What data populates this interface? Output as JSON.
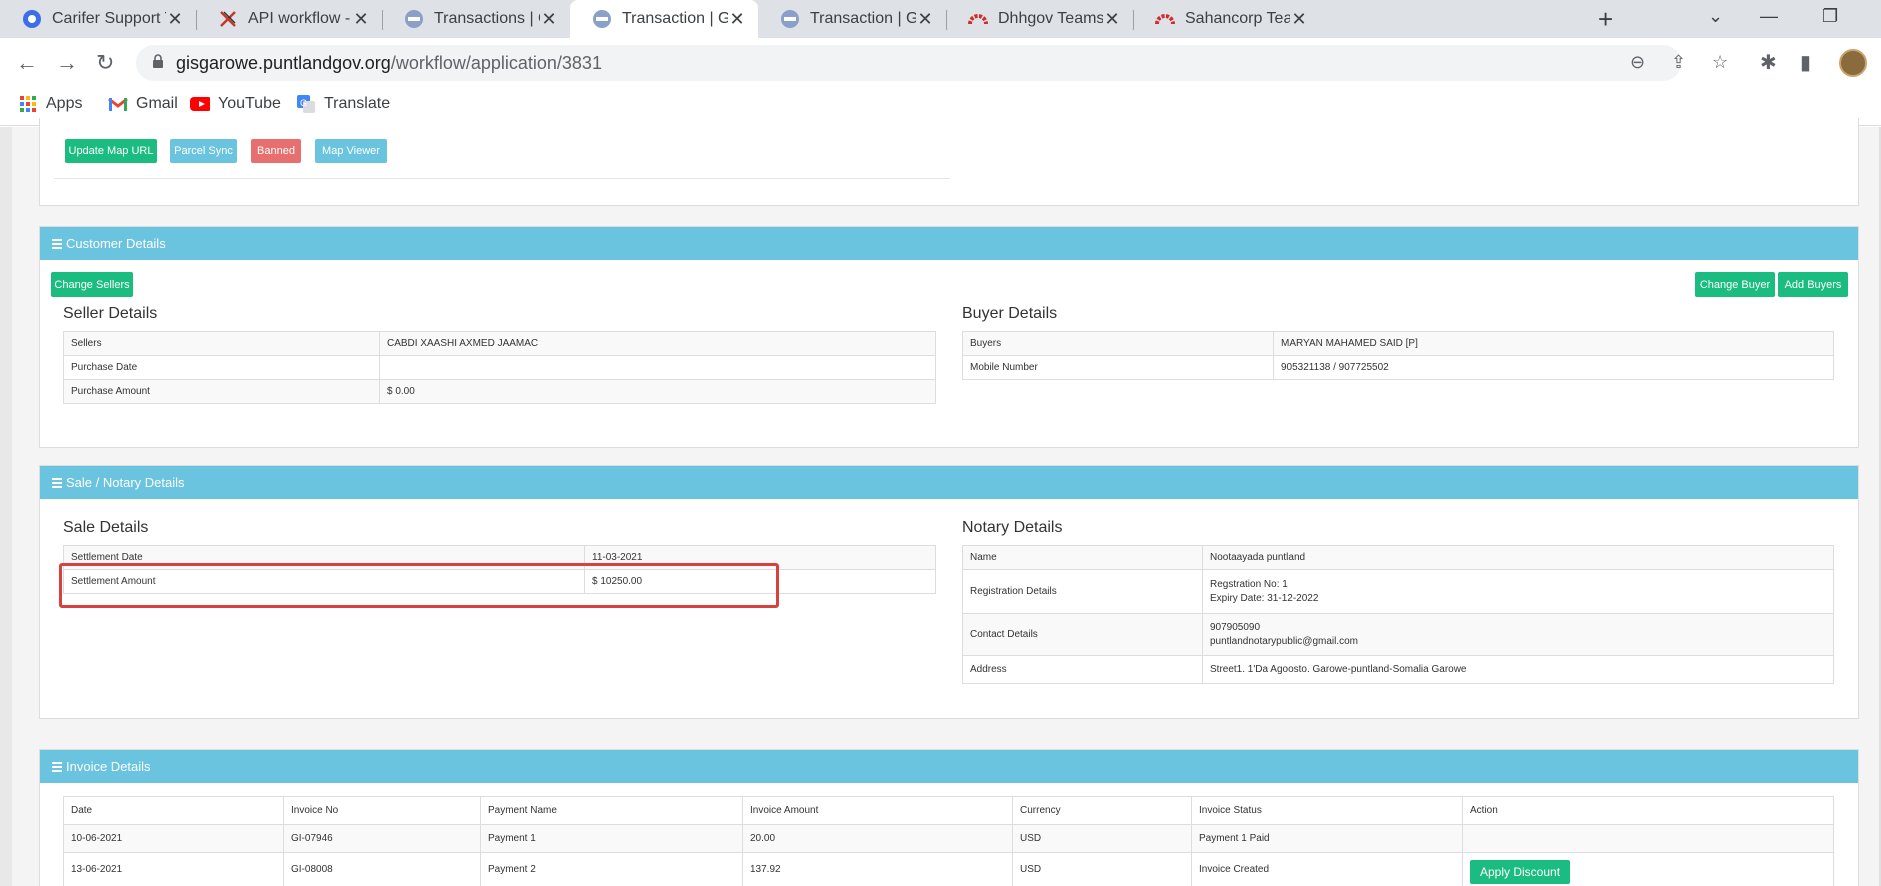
{
  "browser": {
    "tabs": [
      {
        "title": "Carifer Support Team",
        "icon": "carifer-icon",
        "active": false
      },
      {
        "title": "API workflow - XWiki",
        "icon": "xwiki-icon",
        "active": false
      },
      {
        "title": "Transactions | GIS Port",
        "icon": "gis-portal-icon",
        "active": false
      },
      {
        "title": "Transaction | GIS Porta",
        "icon": "gis-portal-icon",
        "active": true
      },
      {
        "title": "Transaction | GIS Porta",
        "icon": "gis-portal-icon",
        "active": false
      },
      {
        "title": "Dhhgov Teams Portal",
        "icon": "teams-portal-icon",
        "active": false
      },
      {
        "title": "Sahancorp Teams Por",
        "icon": "teams-portal-icon",
        "active": false
      }
    ],
    "url_host": "gisgarowe.puntlandgov.org",
    "url_path": "/workflow/application/3831",
    "bookmarks": [
      {
        "label": "Apps",
        "icon": "apps-grid-icon"
      },
      {
        "label": "Gmail",
        "icon": "gmail-icon"
      },
      {
        "label": "YouTube",
        "icon": "youtube-icon"
      },
      {
        "label": "Translate",
        "icon": "translate-icon"
      }
    ]
  },
  "top_actions": {
    "update_map_url": "Update Map URL",
    "parcel_sync": "Parcel Sync",
    "banned": "Banned",
    "map_viewer": "Map Viewer"
  },
  "customer": {
    "header": "Customer Details",
    "change_sellers": "Change Sellers",
    "change_buyer": "Change Buyer",
    "add_buyers": "Add Buyers",
    "seller_title": "Seller Details",
    "seller_rows": [
      {
        "label": "Sellers",
        "value": "CABDI XAASHI AXMED JAAMAC"
      },
      {
        "label": "Purchase Date",
        "value": ""
      },
      {
        "label": "Purchase Amount",
        "value": "$ 0.00"
      }
    ],
    "buyer_title": "Buyer Details",
    "buyer_rows": [
      {
        "label": "Buyers",
        "value": "MARYAN MAHAMED SAID [P]"
      },
      {
        "label": "Mobile Number",
        "value": "905321138 / 907725502"
      }
    ]
  },
  "sale": {
    "header": "Sale / Notary Details",
    "sale_title": "Sale Details",
    "sale_rows": [
      {
        "label": "Settlement Date",
        "value": "11-03-2021"
      },
      {
        "label": "Settlement Amount",
        "value": "$ 10250.00"
      }
    ],
    "notary_title": "Notary Details",
    "notary_rows": [
      {
        "label": "Name",
        "value": [
          "Nootaayada puntland"
        ]
      },
      {
        "label": "Registration Details",
        "value": [
          "Regstration No: 1",
          "Expiry Date: 31-12-2022"
        ]
      },
      {
        "label": "Contact Details",
        "value": [
          "907905090",
          "puntlandnotarypublic@gmail.com"
        ]
      },
      {
        "label": "Address",
        "value": [
          "Street1. 1'Da Agoosto. Garowe-puntland-Somalia Garowe"
        ]
      }
    ]
  },
  "invoice": {
    "header": "Invoice Details",
    "columns": [
      "Date",
      "Invoice No",
      "Payment Name",
      "Invoice Amount",
      "Currency",
      "Invoice Status",
      "Action"
    ],
    "rows": [
      {
        "date": "10-06-2021",
        "no": "GI-07946",
        "name": "Payment 1",
        "amount": "20.00",
        "currency": "USD",
        "status": "Payment 1 Paid",
        "action": ""
      },
      {
        "date": "13-06-2021",
        "no": "GI-08008",
        "name": "Payment 2",
        "amount": "137.92",
        "currency": "USD",
        "status": "Invoice Created",
        "action": "Apply Discount"
      }
    ]
  }
}
